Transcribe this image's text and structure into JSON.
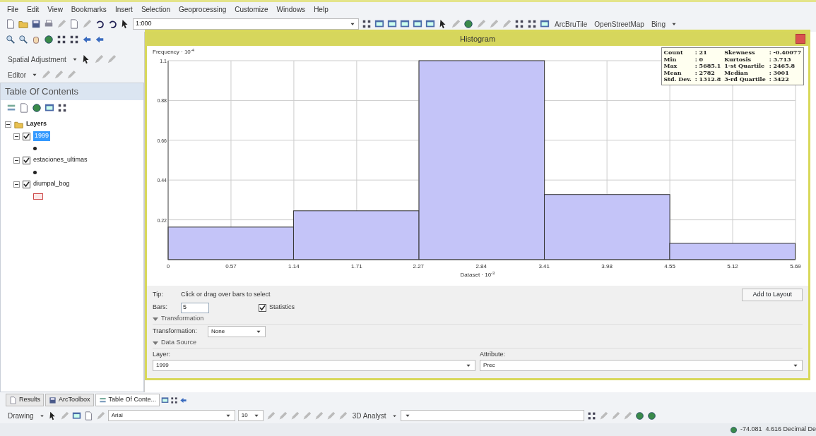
{
  "menu_bar": [
    "File",
    "Edit",
    "View",
    "Bookmarks",
    "Insert",
    "Selection",
    "Geoprocessing",
    "Customize",
    "Windows",
    "Help"
  ],
  "standard_toolbar": {
    "scale": "1:000",
    "dropdowns": [
      "ArcBruTile",
      "OpenStreetMap",
      "Bing"
    ]
  },
  "toolbars": [
    "Spatial Adjustment",
    "Editor"
  ],
  "table_of_contents": {
    "title": "Table Of Contents",
    "layers": {
      "label": "Layers",
      "expanded": true,
      "children": [
        {
          "label": "1999",
          "checked": true,
          "selected": true,
          "expanded": true,
          "kind": "point"
        },
        {
          "label": "estaciones_ultimas",
          "checked": true,
          "selected": false,
          "expanded": true,
          "kind": "point"
        },
        {
          "label": "diumpal_bog",
          "checked": true,
          "selected": false,
          "expanded": true,
          "kind": "polygon"
        }
      ]
    }
  },
  "histogram": {
    "title": "Histogram",
    "ylabel": "Frequency · 10$^{-4}$",
    "xlabel": "Dataset · 10$^{-3}$",
    "chart_data": {
      "type": "bar",
      "grid": true,
      "x": [
        0.569,
        1.706,
        2.844,
        3.981,
        5.118
      ],
      "values": [
        0.18,
        0.27,
        1.1,
        0.36,
        0.09
      ],
      "xlim": [
        0,
        5.69
      ],
      "ylim": [
        0,
        1.1
      ],
      "xticks": [
        {
          "value": 0,
          "label": "0"
        },
        {
          "value": 0.57,
          "label": "0.57"
        },
        {
          "value": 1.14,
          "label": "1.14"
        },
        {
          "value": 1.71,
          "label": "1.71"
        },
        {
          "value": 2.27,
          "label": "2.27"
        },
        {
          "value": 2.84,
          "label": "2.84"
        },
        {
          "value": 3.41,
          "label": "3.41"
        },
        {
          "value": 3.98,
          "label": "3.98"
        },
        {
          "value": 4.55,
          "label": "4.55"
        },
        {
          "value": 5.12,
          "label": "5.12"
        },
        {
          "value": 5.69,
          "label": "5.69"
        }
      ],
      "yticks": [
        {
          "value": 0.22,
          "label": "0.22"
        },
        {
          "value": 0.44,
          "label": "0.44"
        },
        {
          "value": 0.66,
          "label": "0.66"
        },
        {
          "value": 0.88,
          "label": "0.88"
        },
        {
          "value": 1.1,
          "label": "1.1"
        }
      ]
    },
    "statistics": [
      {
        "label": "Count",
        "value": ": 21"
      },
      {
        "label": "Skewness",
        "value": ": -0.40077"
      },
      {
        "label": "Min",
        "value": ": 0"
      },
      {
        "label": "Kurtosis",
        "value": ": 3.713"
      },
      {
        "label": "Max",
        "value": ": 5685.1"
      },
      {
        "label": "1-st Quartile",
        "value": ": 2465.8"
      },
      {
        "label": "Mean",
        "value": ": 2782"
      },
      {
        "label": "Median",
        "value": ": 3001"
      },
      {
        "label": "Std. Dev.",
        "value": ": 1312.8"
      },
      {
        "label": "3-rd Quartile",
        "value": ": 3422"
      }
    ],
    "tip_label": "Tip:",
    "tip": "Click or drag over bars to select",
    "add_button": "Add to Layout",
    "bars_label": "Bars:",
    "bars_value": "5",
    "statistics_checkbox": {
      "label": "Statistics",
      "checked": true
    },
    "transformation_section": {
      "title": "Transformation",
      "expanded": true,
      "label": "Transformation:",
      "value": "None"
    },
    "data_source_section": {
      "title": "Data Source",
      "expanded": true,
      "layer_label": "Layer:",
      "layer_value": "1999",
      "attribute_label": "Attribute:",
      "attribute_value": "Prec"
    }
  },
  "dock_tabs": [
    {
      "label": "Results",
      "selected": false
    },
    {
      "label": "ArcToolbox",
      "selected": false
    },
    {
      "label": "Table Of Conte...",
      "selected": true
    }
  ],
  "drawing_toolbar": {
    "label": "Drawing",
    "font": "Arial",
    "size": "10",
    "analyst": "3D Analyst"
  },
  "status_bar": {
    "coordinates": "-74.081  4.616 Decimal De"
  }
}
